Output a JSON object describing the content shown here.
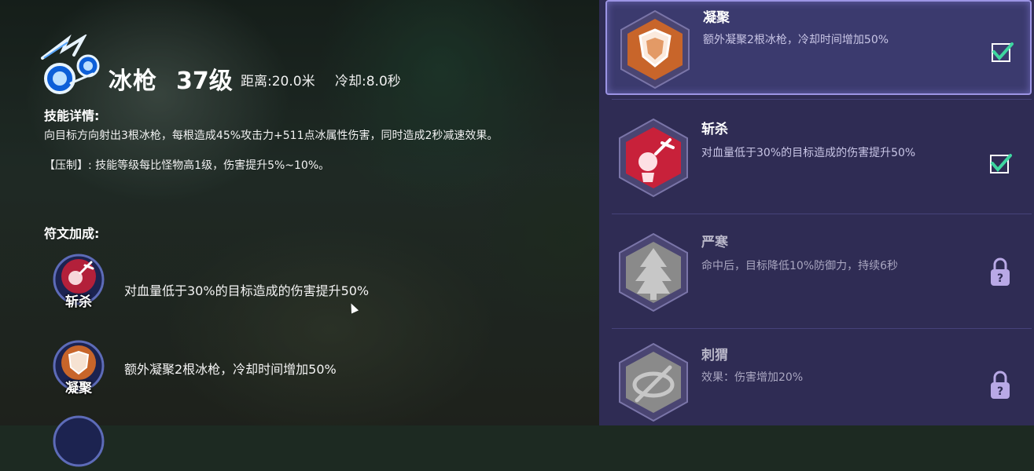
{
  "skill": {
    "name": "冰枪",
    "level": "37级",
    "range": "距离:20.0米",
    "cooldown": "冷却:8.0秒",
    "icon": "ice-spear-icon",
    "detail_heading": "技能详情:",
    "detail_text": "向目标方向射出3根冰枪，每根造成45%攻击力+511点冰属性伤害，同时造成2秒减速效果。",
    "suppress_text": "【压制】: 技能等级每比怪物高1级，伤害提升5%~10%。"
  },
  "equipped_runes": {
    "heading": "符文加成:",
    "items": [
      {
        "label": "斩杀",
        "desc": "对血量低于30%的目标造成的伤害提升50%",
        "icon": "slash-rune-icon"
      },
      {
        "label": "凝聚",
        "desc": "额外凝聚2根冰枪，冷却时间增加50%",
        "icon": "shield-rune-icon"
      }
    ]
  },
  "rune_list": [
    {
      "title": "凝聚",
      "desc": "额外凝聚2根冰枪，冷却时间增加50%",
      "state": "selected",
      "status_icon": "check-icon",
      "icon": "shield-rune-icon",
      "color": "#c8652a"
    },
    {
      "title": "斩杀",
      "desc": "对血量低于30%的目标造成的伤害提升50%",
      "state": "unlocked",
      "status_icon": "check-icon",
      "icon": "slash-rune-icon",
      "color": "#c8213a"
    },
    {
      "title": "严寒",
      "desc": "命中后，目标降低10%防御力，持续6秒",
      "state": "locked",
      "status_icon": "lock-icon",
      "icon": "frost-tree-icon",
      "color": "#8a8a8a"
    },
    {
      "title": "刺猬",
      "desc": "效果：伤害增加20%",
      "state": "locked",
      "status_icon": "lock-icon",
      "icon": "hedgehog-icon",
      "color": "#8a8a8a"
    }
  ],
  "colors": {
    "panel_bg": "#2f2c54",
    "selected_border": "#9c94e4",
    "check": "#3ed6a0"
  }
}
